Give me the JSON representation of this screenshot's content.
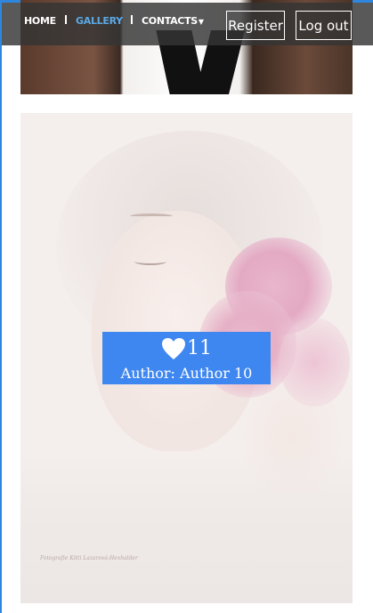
{
  "nav": {
    "items": [
      {
        "label": "HOME"
      },
      {
        "label": "GALLERY"
      },
      {
        "label": "CONTACTS"
      }
    ],
    "active_color": "#5aa9e6",
    "register_label": "Register",
    "logout_label": "Log out"
  },
  "gallery_card": {
    "likes": "11",
    "author_line": "Author: Author 10",
    "overlay_color": "#3f87f0",
    "watermark": "Fotografie Kitti Lazarová-Hexhalder"
  }
}
